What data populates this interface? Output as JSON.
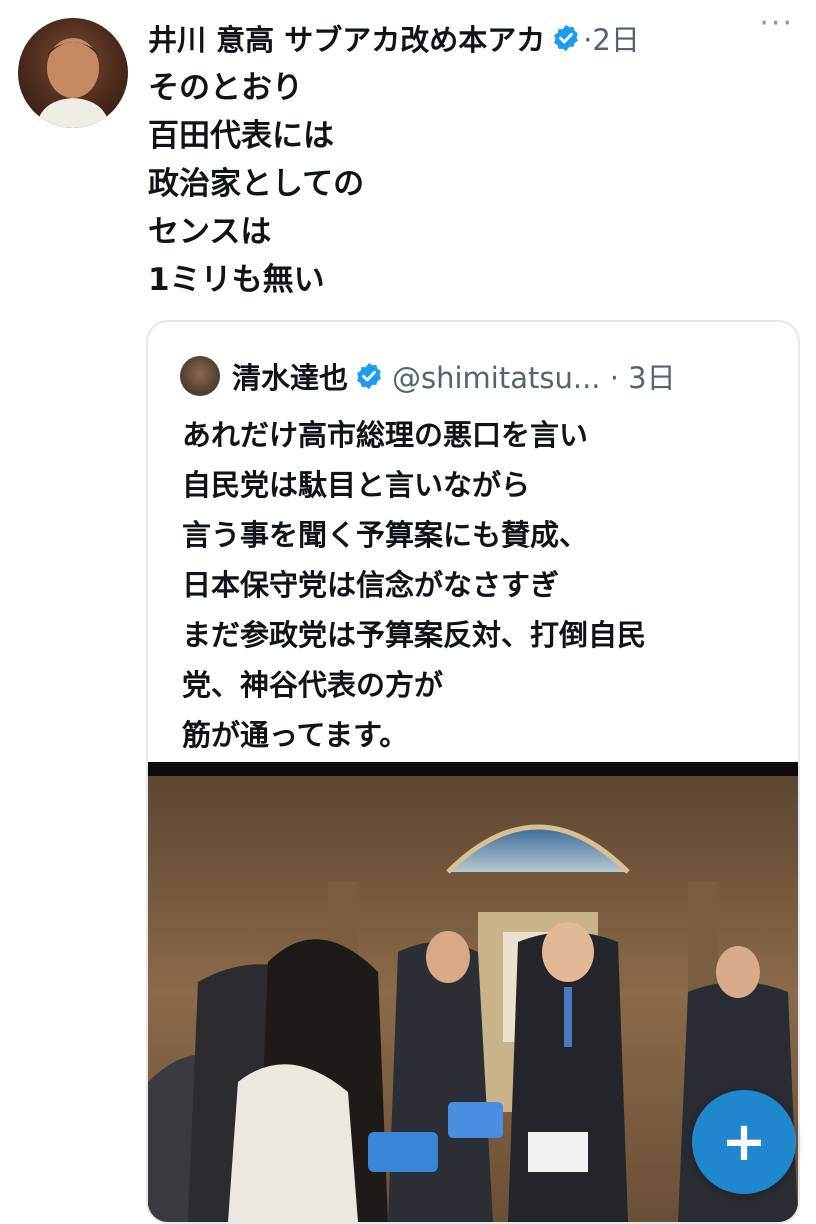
{
  "post": {
    "author_name": "井川 意高 サブアカ改め本アカ",
    "meta": "·2日",
    "more_label": "···",
    "text_lines": [
      "そのとおり",
      "百田代表には",
      "政治家としての",
      "センスは",
      "1ミリも無い"
    ]
  },
  "quoted": {
    "author_name": "清水達也",
    "handle_meta": "@shimitatsu... · 3日",
    "text_lines": [
      "あれだけ高市総理の悪口を言い",
      "自民党は駄目と言いながら",
      "言う事を聞く予算案にも賛成、",
      "日本保守党は信念がなさすぎ",
      "まだ参政党は予算案反対、打倒自民",
      "党、神谷代表の方が",
      "筋が通ってます。"
    ]
  },
  "fab": {
    "label": "+"
  },
  "colors": {
    "verified": "#1d9bf0",
    "muted": "#536471",
    "fab": "#1d9bf0"
  }
}
